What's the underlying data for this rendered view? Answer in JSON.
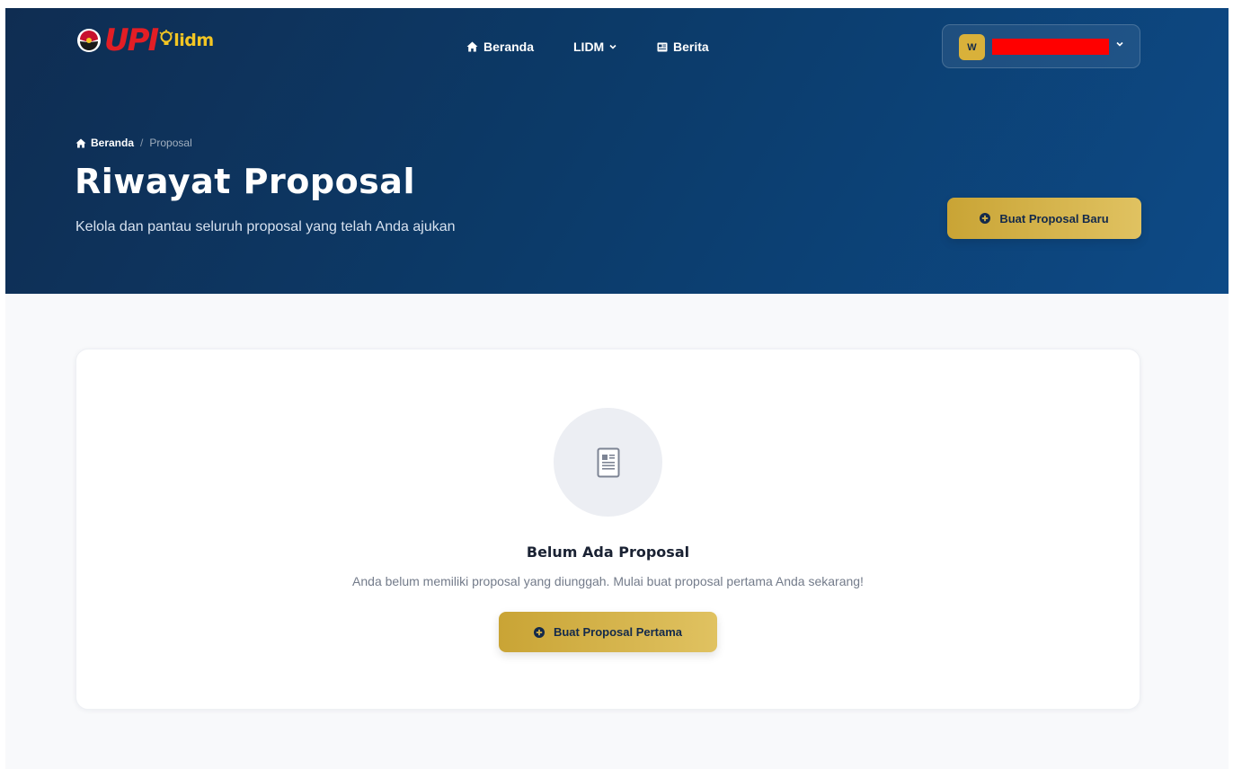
{
  "brand": {
    "logo_text": "UPI",
    "sub_logo_text": "lidm"
  },
  "nav": {
    "items": [
      {
        "label": "Beranda",
        "icon": "home-icon"
      },
      {
        "label": "LIDM",
        "icon": "chevron-down-icon"
      },
      {
        "label": "Berita",
        "icon": "newspaper-icon"
      }
    ]
  },
  "user": {
    "initial": "W",
    "name_redacted": true,
    "icon": "chevron-down-icon"
  },
  "breadcrumb": {
    "home": "Beranda",
    "separator": "/",
    "current": "Proposal"
  },
  "header": {
    "title": "Riwayat Proposal",
    "subtitle": "Kelola dan pantau seluruh proposal yang telah Anda ajukan",
    "new_button": "Buat Proposal Baru"
  },
  "empty_state": {
    "icon": "document-icon",
    "title": "Belum Ada Proposal",
    "description": "Anda belum memiliki proposal yang diunggah. Mulai buat proposal pertama Anda sekarang!",
    "button": "Buat Proposal Pertama"
  },
  "colors": {
    "hero_start": "#0f2d52",
    "hero_end": "#0d4a86",
    "gold": "#d4b248",
    "brand_red": "#e31e25",
    "redaction": "#ff0000"
  }
}
